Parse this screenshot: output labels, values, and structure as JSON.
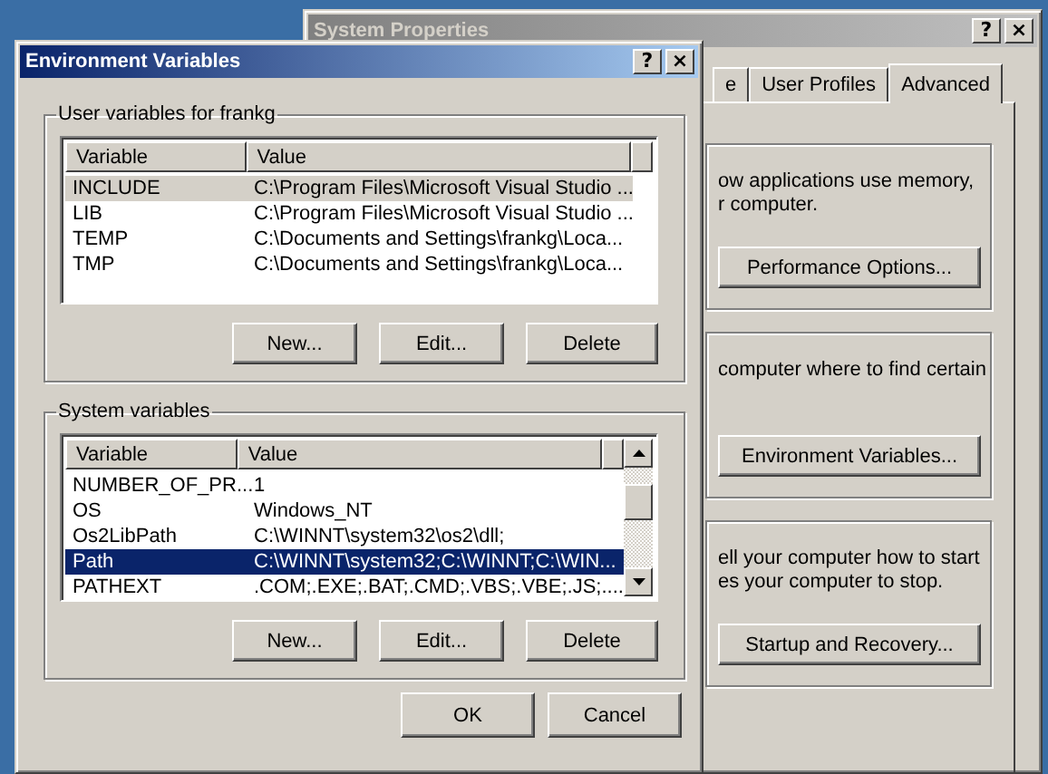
{
  "system_properties": {
    "title": "System Properties",
    "active": false,
    "title_buttons": [
      "?",
      "×"
    ],
    "tabs": [
      {
        "label": "e",
        "selected": false
      },
      {
        "label": "User Profiles",
        "selected": false
      },
      {
        "label": "Advanced",
        "selected": true
      }
    ],
    "groups": [
      {
        "lines": [
          "ow applications use memory,",
          "r computer."
        ],
        "button": "Performance Options..."
      },
      {
        "lines": [
          "computer where to find certain"
        ],
        "button": "Environment Variables..."
      },
      {
        "lines": [
          "ell your computer how to start",
          "es your computer to stop."
        ],
        "button": "Startup and Recovery..."
      }
    ]
  },
  "environment_variables": {
    "title": "Environment Variables",
    "active": true,
    "title_buttons": [
      "?",
      "×"
    ],
    "user_variables": {
      "label": "User variables for frankg",
      "focused": false,
      "scrollbar": false,
      "columns": [
        "Variable",
        "Value"
      ],
      "rows": [
        {
          "variable": "INCLUDE",
          "value": "C:\\Program Files\\Microsoft Visual Studio ...",
          "selected": true
        },
        {
          "variable": "LIB",
          "value": "C:\\Program Files\\Microsoft Visual Studio ...",
          "selected": false
        },
        {
          "variable": "TEMP",
          "value": "C:\\Documents and Settings\\frankg\\Loca...",
          "selected": false
        },
        {
          "variable": "TMP",
          "value": "C:\\Documents and Settings\\frankg\\Loca...",
          "selected": false
        }
      ],
      "buttons": [
        "New...",
        "Edit...",
        "Delete"
      ]
    },
    "system_variables": {
      "label": "System variables",
      "focused": true,
      "scrollbar": true,
      "columns": [
        "Variable",
        "Value"
      ],
      "rows": [
        {
          "variable": "NUMBER_OF_PR...",
          "value": "1",
          "selected": false
        },
        {
          "variable": "OS",
          "value": "Windows_NT",
          "selected": false
        },
        {
          "variable": "Os2LibPath",
          "value": "C:\\WINNT\\system32\\os2\\dll;",
          "selected": false
        },
        {
          "variable": "Path",
          "value": "C:\\WINNT\\system32;C:\\WINNT;C:\\WIN...",
          "selected": true
        },
        {
          "variable": "PATHEXT",
          "value": ".COM;.EXE;.BAT;.CMD;.VBS;.VBE;.JS;....",
          "selected": false
        }
      ],
      "buttons": [
        "New...",
        "Edit...",
        "Delete"
      ]
    },
    "buttons": [
      "OK",
      "Cancel"
    ]
  }
}
